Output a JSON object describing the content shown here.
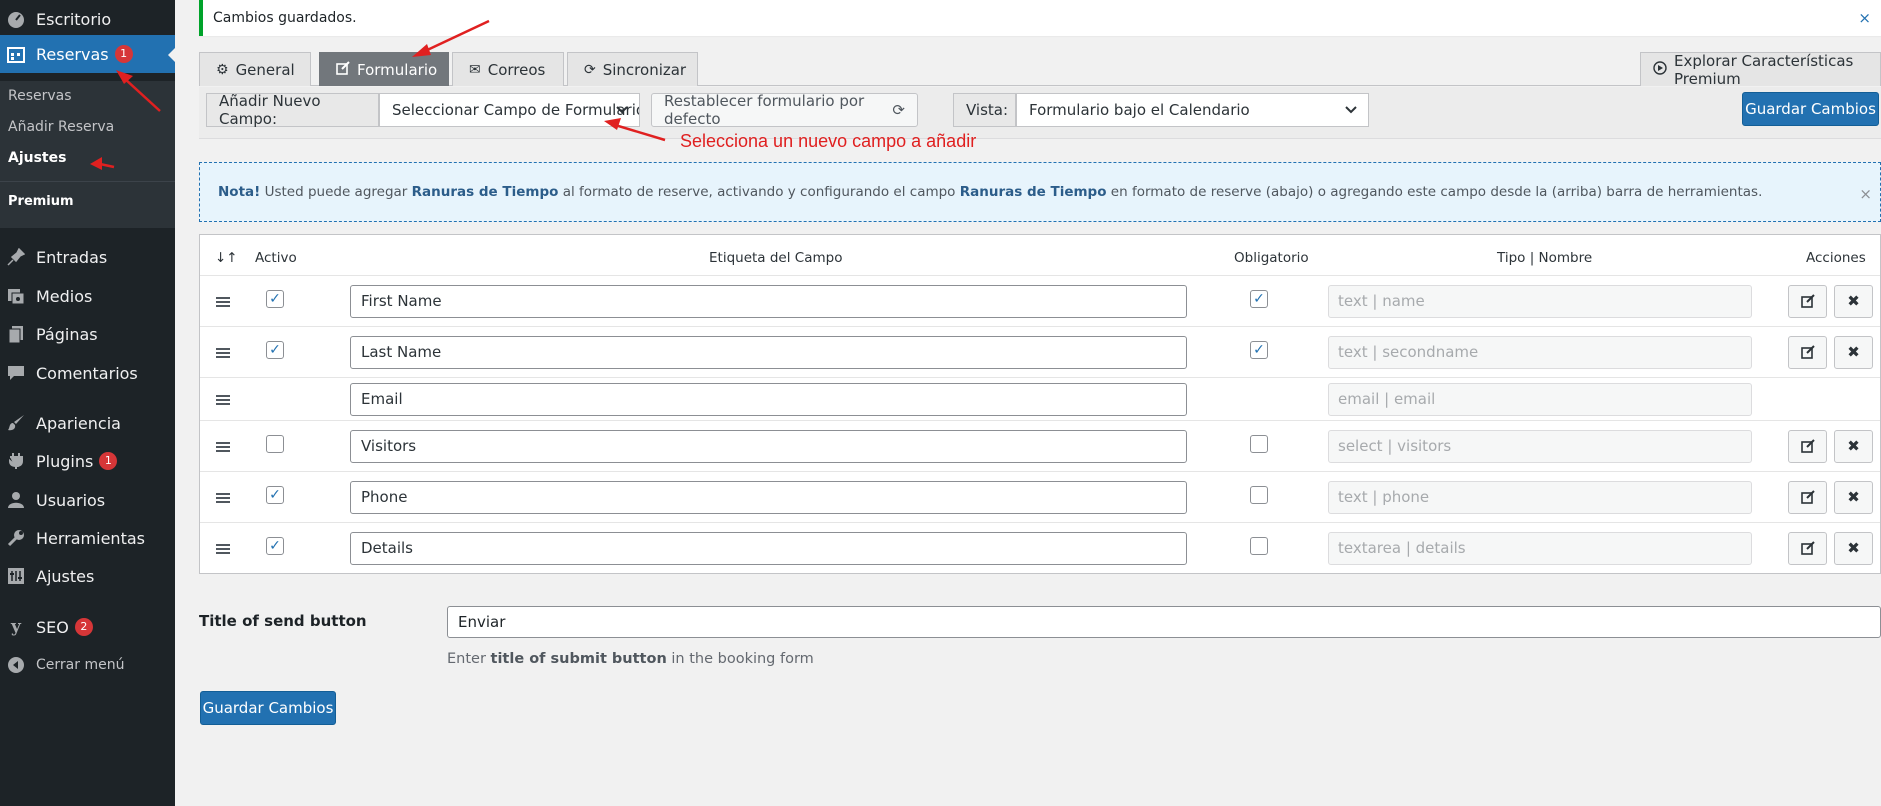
{
  "sidebar": {
    "items": [
      {
        "label": "Escritorio",
        "icon": "dashboard-icon"
      },
      {
        "label": "Reservas",
        "icon": "calendar-icon",
        "badge": "1",
        "active": true
      },
      {
        "label": "Entradas",
        "icon": "pin-icon"
      },
      {
        "label": "Medios",
        "icon": "media-icon"
      },
      {
        "label": "Páginas",
        "icon": "pages-icon"
      },
      {
        "label": "Comentarios",
        "icon": "comments-icon"
      },
      {
        "label": "Apariencia",
        "icon": "brush-icon"
      },
      {
        "label": "Plugins",
        "icon": "plugin-icon",
        "badge": "1"
      },
      {
        "label": "Usuarios",
        "icon": "user-icon"
      },
      {
        "label": "Herramientas",
        "icon": "wrench-icon"
      },
      {
        "label": "Ajustes",
        "icon": "settings-icon"
      },
      {
        "label": "SEO",
        "icon": "yoast-icon",
        "badge": "2"
      },
      {
        "label": "Cerrar menú",
        "icon": "collapse-icon"
      }
    ],
    "submenu": [
      "Reservas",
      "Añadir Reserva",
      "Ajustes",
      "Premium"
    ]
  },
  "notice": {
    "text": "Cambios guardados.",
    "close": "×"
  },
  "tabs": [
    {
      "label": "General",
      "icon": "gear-icon"
    },
    {
      "label": "Formulario",
      "icon": "edit-icon",
      "active": true
    },
    {
      "label": "Correos",
      "icon": "envelope-icon"
    },
    {
      "label": "Sincronizar",
      "icon": "sync-icon"
    }
  ],
  "premium_tab": {
    "label": "Explorar Características Premium",
    "icon": "play-circle-icon"
  },
  "toolbar": {
    "add_field_label": "Añadir Nuevo Campo:",
    "add_field_select": "Seleccionar Campo de Formulario",
    "reset_button": "Restablecer formulario por defecto",
    "view_label": "Vista:",
    "view_select": "Formulario bajo el Calendario",
    "save_button": "Guardar Cambios"
  },
  "annotation": "Selecciona un nuevo campo a añadir",
  "info": {
    "note": "Nota!",
    "text1": " Usted puede agregar ",
    "highlight1": "Ranuras de Tiempo",
    "text2": " al formato de reserve, activando y configurando el campo ",
    "highlight2": "Ranuras de Tiempo",
    "text3": " en formato de reserve (abajo) o agregando este campo desde la (arriba) barra de herramientas.",
    "close": "×"
  },
  "table": {
    "headers": {
      "sort": "↓↑",
      "active": "Activo",
      "label": "Etiqueta del Campo",
      "required": "Obligatorio",
      "type": "Tipo | Nombre",
      "actions": "Acciones"
    },
    "rows": [
      {
        "active": true,
        "label": "First Name",
        "required": true,
        "type": "text | name",
        "actions": true
      },
      {
        "active": true,
        "label": "Last Name",
        "required": true,
        "type": "text | secondname",
        "actions": true
      },
      {
        "active": null,
        "label": "Email",
        "required": null,
        "type": "email | email",
        "actions": false
      },
      {
        "active": false,
        "label": "Visitors",
        "required": false,
        "type": "select | visitors",
        "actions": true
      },
      {
        "active": true,
        "label": "Phone",
        "required": false,
        "type": "text | phone",
        "actions": true
      },
      {
        "active": true,
        "label": "Details",
        "required": false,
        "type": "textarea | details",
        "actions": true
      }
    ]
  },
  "send_button": {
    "label": "Title of send button",
    "value": "Enviar",
    "desc_pre": "Enter ",
    "desc_bold": "title of submit button",
    "desc_post": " in the booking form"
  },
  "bottom_save": "Guardar Cambios",
  "colors": {
    "accent": "#2271b1",
    "sidebar": "#1d2327",
    "badge": "#d63638",
    "annotation": "#e02020"
  }
}
